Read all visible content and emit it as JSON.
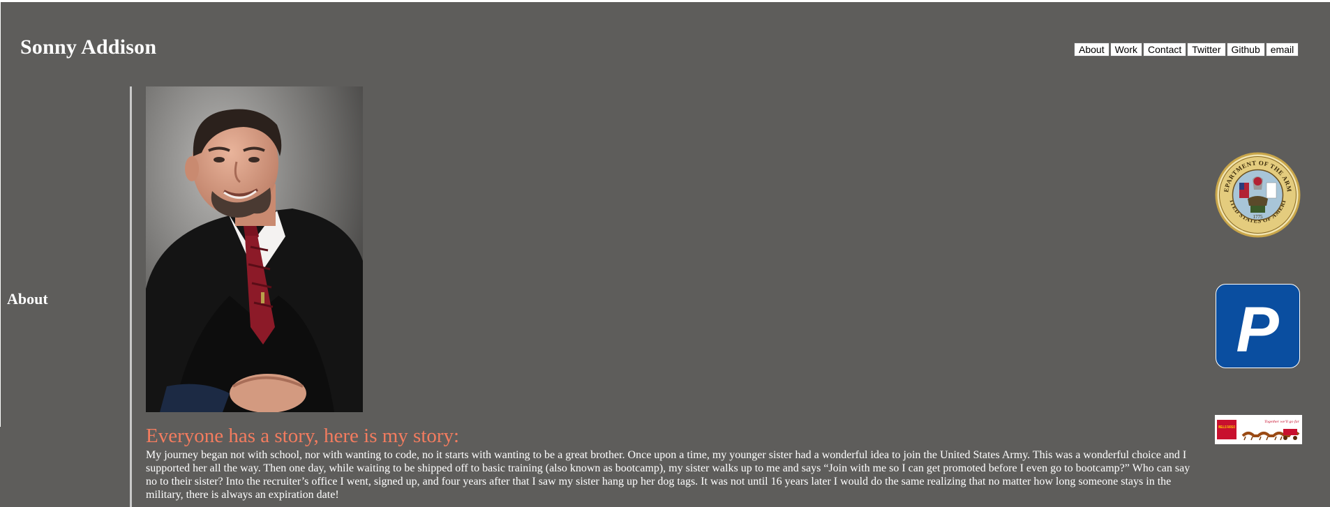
{
  "site": {
    "title": "Sonny Addison"
  },
  "nav": {
    "items": [
      {
        "label": "About",
        "name": "nav-about-button"
      },
      {
        "label": "Work",
        "name": "nav-work-button"
      },
      {
        "label": "Contact",
        "name": "nav-contact-button"
      },
      {
        "label": "Twitter",
        "name": "nav-twitter-button"
      },
      {
        "label": "Github",
        "name": "nav-github-button"
      },
      {
        "label": "email",
        "name": "nav-email-button"
      }
    ]
  },
  "section": {
    "heading": "About"
  },
  "story": {
    "heading": "Everyone has a story, here is my story:",
    "body": "My journey began not with school, nor with wanting to code, no it starts with wanting to be a great brother. Once upon a time, my younger sister had a wonderful idea to join the United States Army. This was a wonderful choice and I supported her all the way. Then one day, while waiting to be shipped off to basic training (also known as bootcamp), my sister walks up to me and says “Join with me so I can get promoted before I even go to bootcamp?” Who can say no to their sister? Into the recruiter’s office I went, signed up, and four years after that I saw my sister hang up her dog tags. It was not until 16 years later I would do the same realizing that no matter how long someone stays in the military, there is always an expiration date!"
  },
  "logos": {
    "army_seal_text_top": "DEPARTMENT OF THE ARMY",
    "army_seal_text_bottom": "UNITED STATES OF AMERICA",
    "army_seal_year": "1775",
    "p_logo_letter": "P",
    "wf_badge_text": "WELLS FARGO",
    "wf_tagline": "Together we'll go far"
  },
  "colors": {
    "background": "#5e5d5b",
    "heading_accent": "#f37c5f",
    "text": "#ffffff",
    "p_logo_blue": "#0a4ea0",
    "wf_red": "#c8102e"
  }
}
